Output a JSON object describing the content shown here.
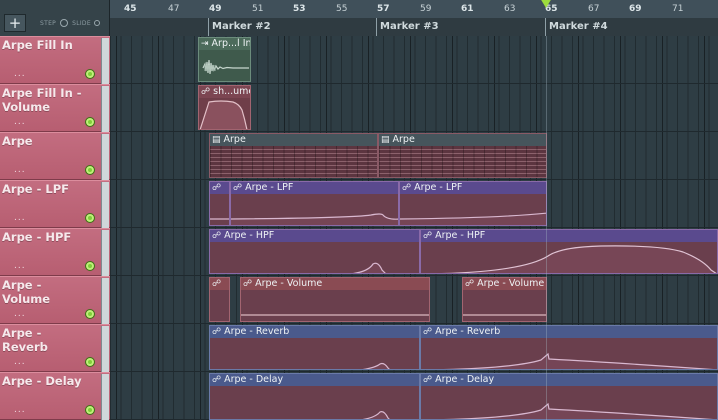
{
  "toolbar": {
    "add_label": "+",
    "step_label": "STEP",
    "slide_label": "SLIDE"
  },
  "ruler": {
    "bars": [
      "45",
      "47",
      "49",
      "51",
      "53",
      "55",
      "57",
      "59",
      "61",
      "63",
      "65",
      "67",
      "69",
      "71"
    ],
    "markers": [
      "Marker #2",
      "Marker #3",
      "Marker #4"
    ]
  },
  "tracks": [
    {
      "name": "Arpe Fill In",
      "dots": "..."
    },
    {
      "name": "Arpe Fill In - Volume",
      "dots": "..."
    },
    {
      "name": "Arpe",
      "dots": "..."
    },
    {
      "name": "Arpe - LPF",
      "dots": "..."
    },
    {
      "name": "Arpe - HPF",
      "dots": "..."
    },
    {
      "name": "Arpe - Volume",
      "dots": "..."
    },
    {
      "name": "Arpe - Reverb",
      "dots": "..."
    },
    {
      "name": "Arpe - Delay",
      "dots": "..."
    }
  ],
  "clips": {
    "fill_in": "Arp...l In",
    "fill_in_volume": "sh...ume",
    "arpe": [
      "Arpe",
      "Arpe"
    ],
    "lpf": [
      "Arpe - LPF",
      "Arpe - LPF"
    ],
    "hpf": [
      "Arpe - HPF",
      "Arpe - HPF"
    ],
    "volume": [
      "Arpe - Volume",
      "Arpe - Volume"
    ],
    "reverb": [
      "Arpe - Reverb",
      "Arpe - Reverb"
    ],
    "delay": [
      "Arpe - Delay",
      "Arpe - Delay"
    ]
  },
  "icons": {
    "add": "plus-icon",
    "automation": "automation-clip-icon",
    "pattern": "pattern-clip-icon",
    "audio": "audio-clip-icon",
    "mute": "mute-led-icon",
    "playhead": "playhead-icon"
  },
  "colors": {
    "track_header": "#c06a7c",
    "lane_bg": "#2e3d44",
    "pattern_clip": "#6e3c48",
    "lpf_clip": "#5a4a8e",
    "hpf_clip": "#5a4a8e",
    "volume_clip": "#8a4b53",
    "reverb_clip": "#4a5a8c",
    "delay_clip": "#4a5a8c",
    "playhead": "#9ddc3d",
    "mute_led": "#7fcf3a"
  }
}
